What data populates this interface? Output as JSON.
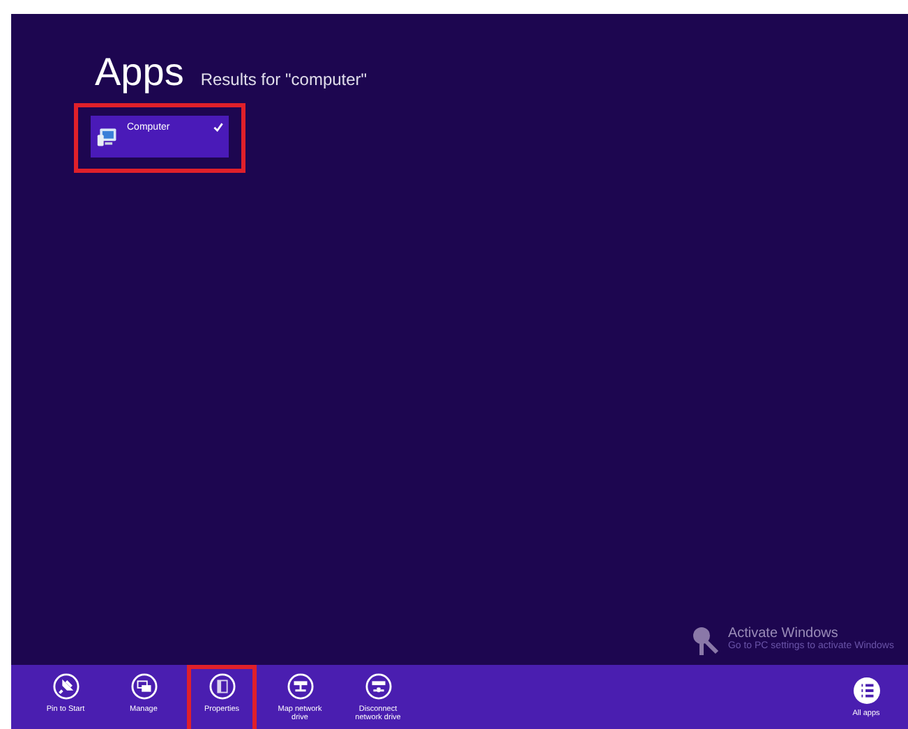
{
  "header": {
    "title": "Apps",
    "subtitle": "Results for \"computer\""
  },
  "results": [
    {
      "label": "Computer",
      "selected": true,
      "highlighted": true
    }
  ],
  "app_bar": {
    "commands": [
      {
        "kind": "pin",
        "label": "Pin to Start",
        "highlighted": false
      },
      {
        "kind": "manage",
        "label": "Manage",
        "highlighted": false
      },
      {
        "kind": "properties",
        "label": "Properties",
        "highlighted": true
      },
      {
        "kind": "map",
        "label": "Map network drive",
        "highlighted": false
      },
      {
        "kind": "disconnect",
        "label": "Disconnect network drive",
        "highlighted": false
      }
    ],
    "right_command": {
      "kind": "allapps",
      "label": "All apps"
    }
  },
  "activation_notice": {
    "title": "Activate Windows",
    "message": "Go to PC settings to activate Windows"
  }
}
